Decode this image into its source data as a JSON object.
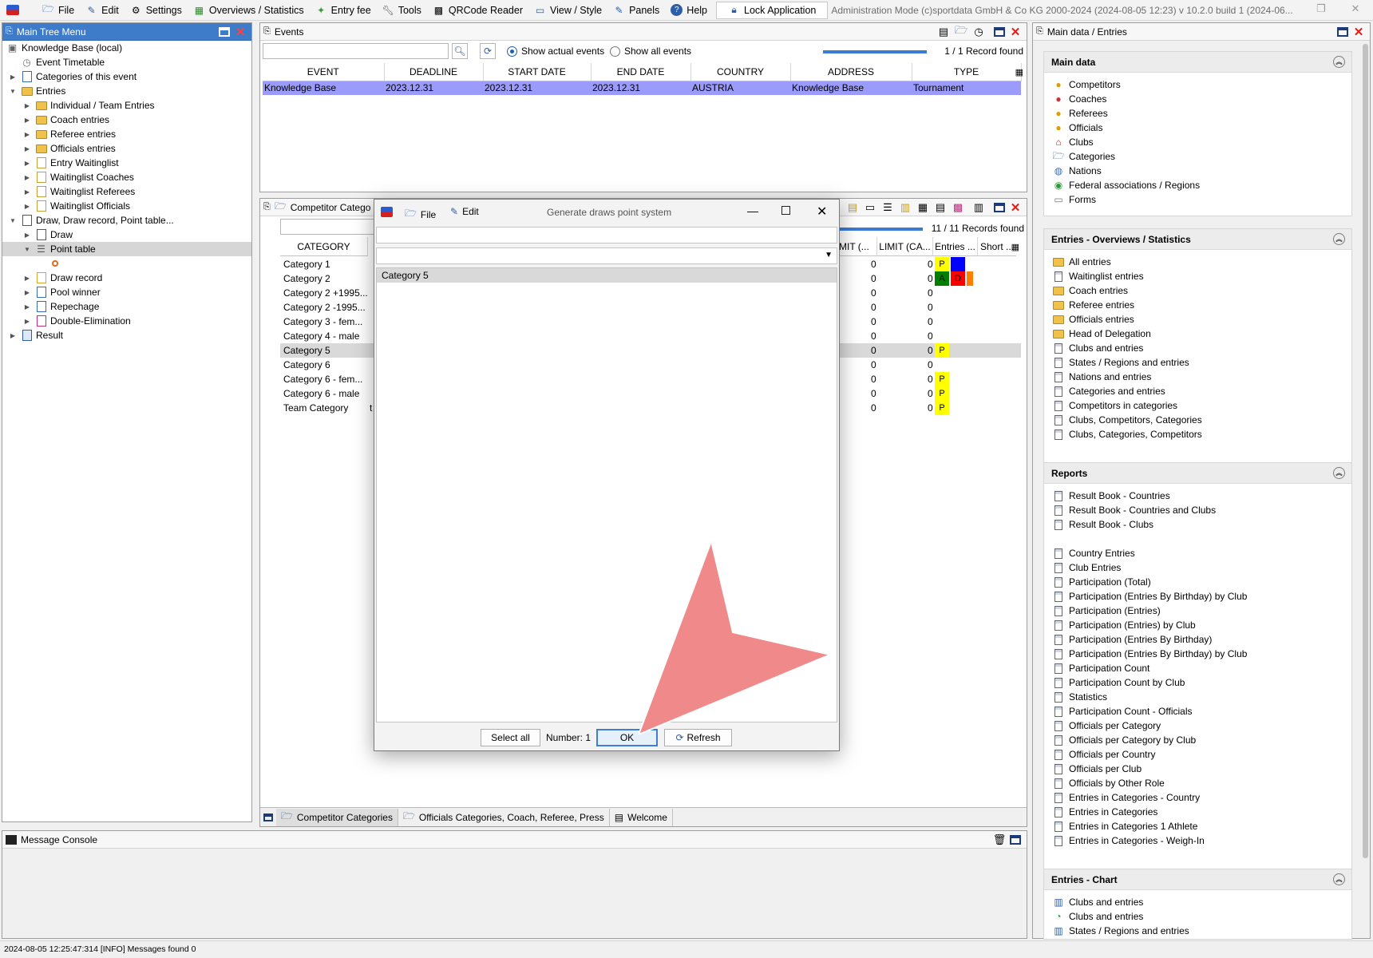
{
  "menubar": {
    "items": [
      "File",
      "Edit",
      "Settings",
      "Overviews / Statistics",
      "Entry fee",
      "Tools",
      "QRCode Reader",
      "View / Style",
      "Panels",
      "Help"
    ],
    "lock": "Lock Application",
    "status": "Administration Mode (c)sportdata GmbH & Co KG 2000-2024 (2024-08-05 12:23)  v 10.2.0 build 1 (2024-06..."
  },
  "tree": {
    "title": "Main Tree Menu",
    "rows": [
      "Knowledge Base (local)",
      "Event Timetable",
      "Categories of this event",
      "Entries",
      "Individual / Team Entries",
      "Coach entries",
      "Referee entries",
      "Officials entries",
      "Entry Waitinglist",
      "Waitinglist Coaches",
      "Waitinglist Referees",
      "Waitinglist Officials",
      "Draw, Draw record, Point table...",
      "Draw",
      "Point table",
      "",
      "Draw record",
      "Pool winner",
      "Repechage",
      "Double-Elimination",
      "Result"
    ]
  },
  "events": {
    "title": "Events",
    "radio_actual": "Show actual events",
    "radio_all": "Show all events",
    "progress": 1.0,
    "record_count": "1 / 1 Record found",
    "columns": [
      "EVENT",
      "DEADLINE",
      "START DATE",
      "END DATE",
      "COUNTRY",
      "ADDRESS",
      "TYPE"
    ],
    "rows": [
      [
        "Knowledge Base",
        "2023.12.31",
        "2023.12.31",
        "2023.12.31",
        "AUSTRIA",
        "Knowledge Base",
        "Tournament"
      ]
    ]
  },
  "categories": {
    "title": "Competitor Catego",
    "record_count": "11 / 11 Records found",
    "col_category": "CATEGORY",
    "col_limit1": "MIT (...",
    "col_limit2": "LIMIT (CA...",
    "col_entries": "Entries ...",
    "col_short": "Short ...",
    "rows": [
      {
        "name": "Category 1",
        "l1": "0",
        "l2": "0",
        "badges": [
          "P",
          "W"
        ]
      },
      {
        "name": "Category 2",
        "l1": "0",
        "l2": "0",
        "badges": [
          "A",
          "D",
          "O"
        ]
      },
      {
        "name": "Category 2 +1995...",
        "l1": "0",
        "l2": "0",
        "badges": []
      },
      {
        "name": "Category 2 -1995...",
        "l1": "0",
        "l2": "0",
        "badges": []
      },
      {
        "name": "Category 3 - fem...",
        "l1": "0",
        "l2": "0",
        "badges": []
      },
      {
        "name": "Category 4 - male",
        "l1": "0",
        "l2": "0",
        "badges": []
      },
      {
        "name": "Category 5",
        "l1": "0",
        "l2": "0",
        "badges": [
          "P"
        ]
      },
      {
        "name": "Category 6",
        "l1": "0",
        "l2": "0",
        "badges": []
      },
      {
        "name": "Category 6 - fem...",
        "l1": "0",
        "l2": "0",
        "badges": [
          "P"
        ]
      },
      {
        "name": "Category 6 - male",
        "l1": "0",
        "l2": "0",
        "badges": [
          "P"
        ]
      },
      {
        "name": "Team Category",
        "l1": "0",
        "l2": "0",
        "badges": [
          "P"
        ]
      }
    ],
    "team_suffix": "t",
    "tabs": [
      "Competitor Categories",
      "Officials Categories, Coach, Referee, Press",
      "Welcome"
    ]
  },
  "console": {
    "title": "Message Console",
    "status": "2024-08-05 12:25:47:314 [INFO] Messages found 0"
  },
  "right": {
    "title": "Main data / Entries",
    "sections": [
      {
        "title": "Main data",
        "items": [
          "Competitors",
          "Coaches",
          "Referees",
          "Officials",
          "Clubs",
          "Categories",
          "Nations",
          "Federal associations / Regions",
          "Forms"
        ]
      },
      {
        "title": "Entries - Overviews / Statistics",
        "items": [
          "All entries",
          "Waitinglist entries",
          "Coach entries",
          "Referee entries",
          "Officials entries",
          "Head of Delegation",
          "Clubs and entries",
          "States / Regions and entries",
          "Nations and entries",
          "Categories and entries",
          "Competitors in categories",
          "Clubs, Competitors, Categories",
          "Clubs, Categories, Competitors"
        ]
      },
      {
        "title": "Reports",
        "items": [
          "Result Book - Countries",
          "Result Book - Countries and Clubs",
          "Result Book - Clubs",
          "",
          "Country Entries",
          "Club Entries",
          "Participation (Total)",
          "Participation (Entries By Birthday) by Club",
          "Participation (Entries)",
          "Participation (Entries) by Club",
          "Participation (Entries By Birthday)",
          "Participation (Entries By Birthday) by Club",
          "Participation Count",
          "Participation Count by Club",
          "Statistics",
          "Participation Count - Officials",
          "Officials per Category",
          "Officials per Category by Club",
          "Officials per Country",
          "Officials per Club",
          "Officials by Other Role",
          "Entries in Categories - Country",
          "Entries in Categories",
          "Entries in Categories 1 Athlete",
          "Entries in Categories - Weigh-In"
        ]
      },
      {
        "title": "Entries - Chart",
        "items": [
          "Clubs and entries",
          "Clubs and entries",
          "States / Regions and entries"
        ]
      }
    ]
  },
  "dialog": {
    "file": "File",
    "edit": "Edit",
    "title": "Generate draws point system",
    "selected_item": "Category 5",
    "select_all": "Select all",
    "number_label": "Number: 1",
    "ok": "OK",
    "refresh": "Refresh"
  },
  "colors": {
    "selection": "#9b9bfb",
    "titlebar_blue": "#3e7cc9",
    "arrow": "#f08a8a"
  }
}
